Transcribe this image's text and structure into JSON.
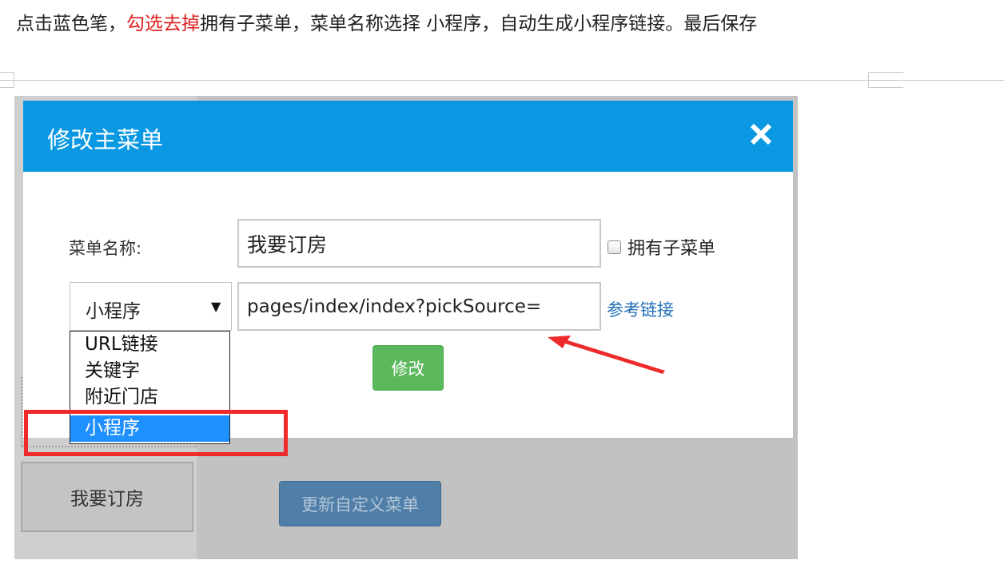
{
  "instruction": {
    "part1": "点击蓝色笔，",
    "part2": "勾选去掉",
    "part3": "拥有子菜单，菜单名称选择 小程序，自动生成小程序链接。最后保存"
  },
  "modal": {
    "title": "修改主菜单",
    "name_label": "菜单名称:",
    "name_value": "我要订房",
    "has_submenu_label": "拥有子菜单",
    "select_value": "小程序",
    "link_value": "pages/index/index?pickSource=",
    "ref_link": "参考链接",
    "modify_button": "修改"
  },
  "dropdown": {
    "options": [
      "URL链接",
      "关键字",
      "附近门店",
      "小程序"
    ]
  },
  "background": {
    "menu_button": "我要订房",
    "update_button": "更新自定义菜单"
  },
  "colors": {
    "header": "#0b98e3",
    "modify": "#5cb85c",
    "highlight": "#ef2a2a",
    "option_selected": "#1e90ff"
  }
}
